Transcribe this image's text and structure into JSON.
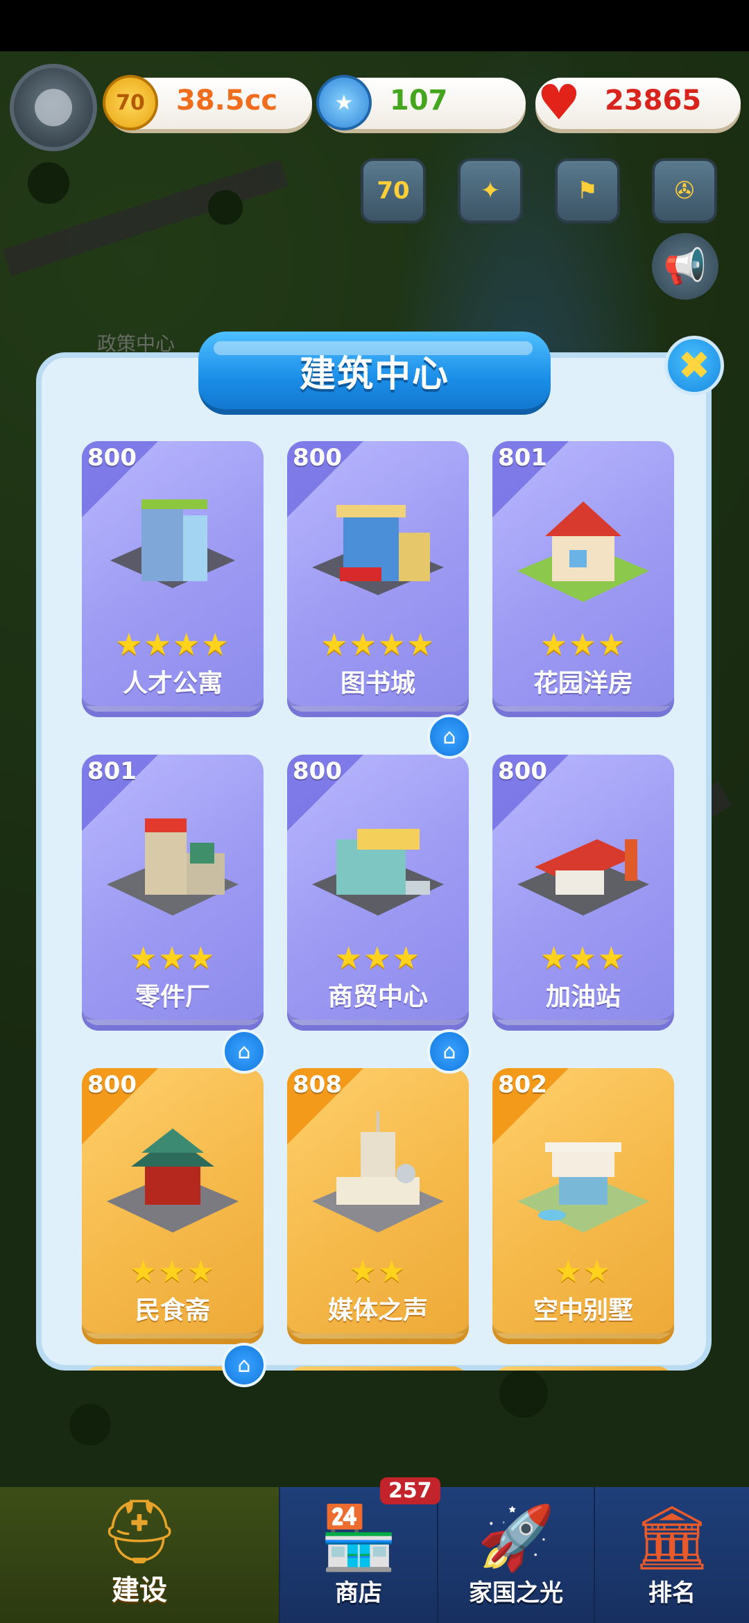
{
  "resources": {
    "gold_badge": "70",
    "gold": "38.5cc",
    "gems": "107",
    "hearts": "23865"
  },
  "quick_icons": [
    "70"
  ],
  "map": {
    "policy_label": "政策中心"
  },
  "dialog": {
    "title": "建筑中心",
    "close_label": "✖"
  },
  "buildings": [
    {
      "level": "800",
      "name": "人才公寓",
      "stars": "★★★★"
    },
    {
      "level": "800",
      "name": "图书城",
      "stars": "★★★★"
    },
    {
      "level": "801",
      "name": "花园洋房",
      "stars": "★★★"
    },
    {
      "level": "801",
      "name": "零件厂",
      "stars": "★★★"
    },
    {
      "level": "800",
      "name": "商贸中心",
      "stars": "★★★"
    },
    {
      "level": "800",
      "name": "加油站",
      "stars": "★★★"
    },
    {
      "level": "800",
      "name": "民食斋",
      "stars": "★★★"
    },
    {
      "level": "808",
      "name": "媒体之声",
      "stars": "★★"
    },
    {
      "level": "802",
      "name": "空中别墅",
      "stars": "★★"
    }
  ],
  "bottom_nav": {
    "build": "建设",
    "shop": "商店",
    "shop_count": "257",
    "home_light": "家国之光",
    "rank": "排名"
  },
  "colors": {
    "purple_card": "#9c9af2",
    "orange_card": "#f5b94a",
    "title_blue": "#1b8ee8"
  }
}
